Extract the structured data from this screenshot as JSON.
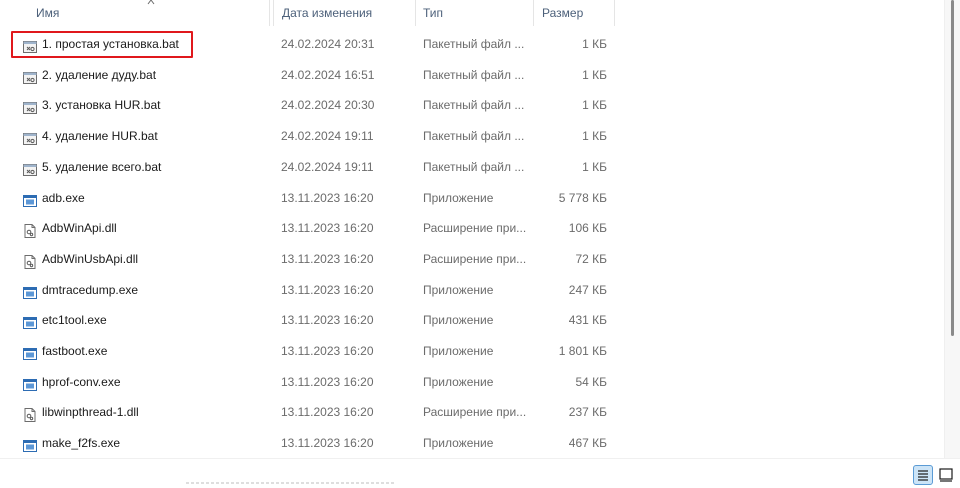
{
  "columns": {
    "name": "Имя",
    "date": "Дата изменения",
    "type": "Тип",
    "size": "Размер"
  },
  "sort": {
    "column": "name",
    "direction": "ascending"
  },
  "highlight_color": "#e0181c",
  "files": [
    {
      "name": "1. простая установка.bat",
      "date": "24.02.2024 20:31",
      "type": "Пакетный файл ...",
      "size": "1 КБ",
      "icon": "batch-file-icon",
      "highlighted": true
    },
    {
      "name": "2. удаление дуду.bat",
      "date": "24.02.2024 16:51",
      "type": "Пакетный файл ...",
      "size": "1 КБ",
      "icon": "batch-file-icon"
    },
    {
      "name": "3. установка HUR.bat",
      "date": "24.02.2024 20:30",
      "type": "Пакетный файл ...",
      "size": "1 КБ",
      "icon": "batch-file-icon"
    },
    {
      "name": "4. удаление HUR.bat",
      "date": "24.02.2024 19:11",
      "type": "Пакетный файл ...",
      "size": "1 КБ",
      "icon": "batch-file-icon"
    },
    {
      "name": "5. удаление всего.bat",
      "date": "24.02.2024 19:11",
      "type": "Пакетный файл ...",
      "size": "1 КБ",
      "icon": "batch-file-icon"
    },
    {
      "name": "adb.exe",
      "date": "13.11.2023 16:20",
      "type": "Приложение",
      "size": "5 778 КБ",
      "icon": "application-icon"
    },
    {
      "name": "AdbWinApi.dll",
      "date": "13.11.2023 16:20",
      "type": "Расширение при...",
      "size": "106 КБ",
      "icon": "dll-file-icon"
    },
    {
      "name": "AdbWinUsbApi.dll",
      "date": "13.11.2023 16:20",
      "type": "Расширение при...",
      "size": "72 КБ",
      "icon": "dll-file-icon"
    },
    {
      "name": "dmtracedump.exe",
      "date": "13.11.2023 16:20",
      "type": "Приложение",
      "size": "247 КБ",
      "icon": "application-icon"
    },
    {
      "name": "etc1tool.exe",
      "date": "13.11.2023 16:20",
      "type": "Приложение",
      "size": "431 КБ",
      "icon": "application-icon"
    },
    {
      "name": "fastboot.exe",
      "date": "13.11.2023 16:20",
      "type": "Приложение",
      "size": "1 801 КБ",
      "icon": "application-icon"
    },
    {
      "name": "hprof-conv.exe",
      "date": "13.11.2023 16:20",
      "type": "Приложение",
      "size": "54 КБ",
      "icon": "application-icon"
    },
    {
      "name": "libwinpthread-1.dll",
      "date": "13.11.2023 16:20",
      "type": "Расширение при...",
      "size": "237 КБ",
      "icon": "dll-file-icon"
    },
    {
      "name": "make_f2fs.exe",
      "date": "13.11.2023 16:20",
      "type": "Приложение",
      "size": "467 КБ",
      "icon": "application-icon"
    }
  ],
  "status_bar": {
    "view_details_icon": "details-view-icon",
    "view_tiles_icon": "large-icons-view-icon",
    "active_view": "details"
  }
}
